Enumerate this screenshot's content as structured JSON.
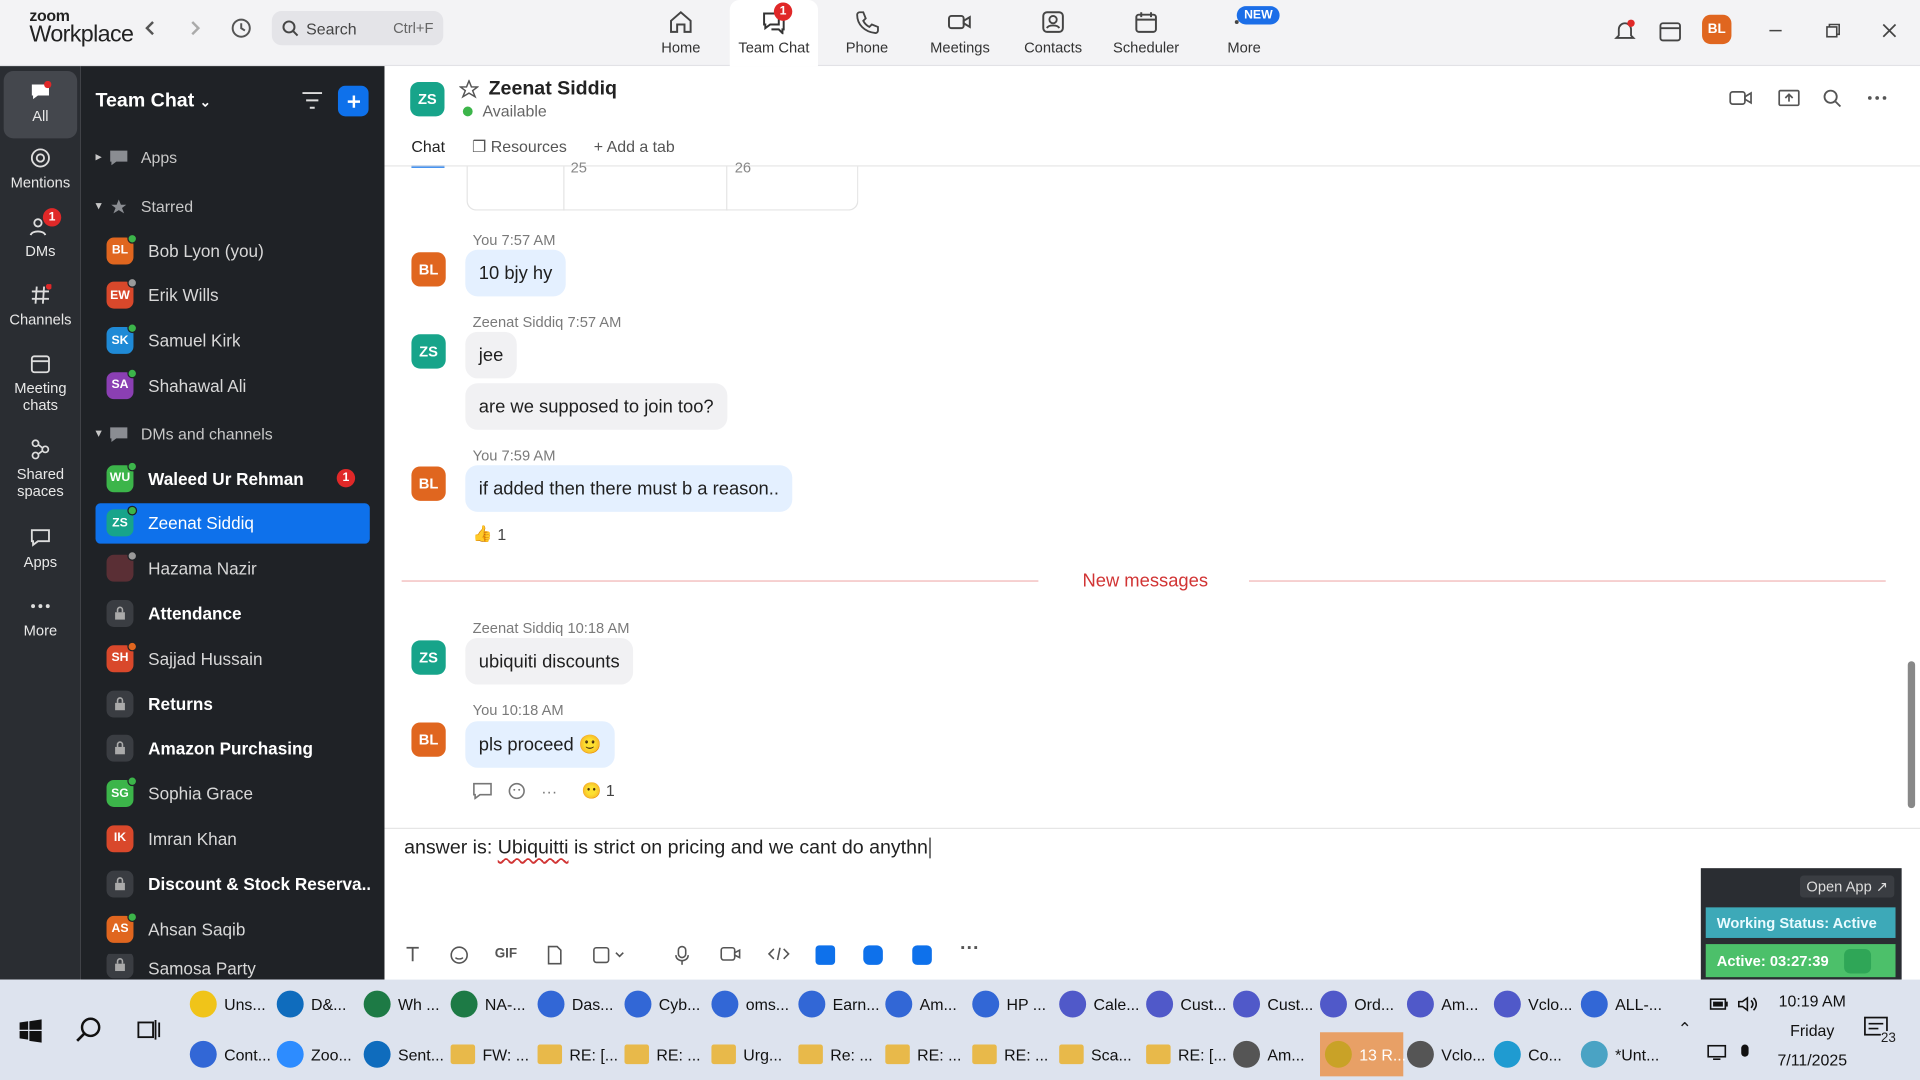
{
  "app": {
    "logo_line1": "zoom",
    "logo_line2": "Workplace"
  },
  "search": {
    "placeholder": "Search",
    "shortcut": "Ctrl+F"
  },
  "topnav": [
    {
      "label": "Home",
      "icon": "home-icon"
    },
    {
      "label": "Team Chat",
      "icon": "chat-icon",
      "badge": "1",
      "active": true
    },
    {
      "label": "Phone",
      "icon": "phone-icon"
    },
    {
      "label": "Meetings",
      "icon": "video-icon"
    },
    {
      "label": "Contacts",
      "icon": "contacts-icon"
    },
    {
      "label": "Scheduler",
      "icon": "calendar-icon"
    },
    {
      "label": "More",
      "icon": "more-icon",
      "badge": "NEW"
    }
  ],
  "user": {
    "initials": "BL",
    "color": "#e0661f"
  },
  "rail": [
    {
      "label": "All",
      "active": true
    },
    {
      "label": "Mentions"
    },
    {
      "label": "DMs",
      "badge": "1"
    },
    {
      "label": "Channels"
    },
    {
      "label": "Meeting chats"
    },
    {
      "label": "Shared spaces"
    },
    {
      "label": "Apps"
    },
    {
      "label": "More"
    }
  ],
  "sidebar": {
    "title": "Team Chat",
    "apps": "Apps",
    "starred": "Starred",
    "dms": "DMs and channels",
    "starred_items": [
      {
        "initials": "BL",
        "name": "Bob Lyon (you)",
        "color": "#e0661f",
        "status": "#3cb54a"
      },
      {
        "initials": "EW",
        "name": "Erik Wills",
        "color": "#d9482b",
        "status": "#9a9a9a"
      },
      {
        "initials": "SK",
        "name": "Samuel Kirk",
        "color": "#1f8ad6",
        "status": "#3cb54a"
      },
      {
        "initials": "SA",
        "name": "Shahawal Ali",
        "color": "#8b3fb3",
        "status": "#3cb54a"
      }
    ],
    "channels": [
      {
        "initials": "WU",
        "name": "Waleed Ur Rehman",
        "color": "#3cb54a",
        "status": "#3cb54a",
        "bold": true,
        "badge": "1"
      },
      {
        "initials": "ZS",
        "name": "Zeenat Siddiq",
        "color": "#17a48a",
        "status": "#3cb54a",
        "selected": true
      },
      {
        "initials": "",
        "name": "Hazama Nazir",
        "color": "#5a2f35",
        "status": "#9a9a9a"
      },
      {
        "initials": "lock",
        "name": "Attendance",
        "bold": true
      },
      {
        "initials": "SH",
        "name": "Sajjad Hussain",
        "color": "#d9482b",
        "status": "#e0661f"
      },
      {
        "initials": "lock",
        "name": "Returns",
        "bold": true
      },
      {
        "initials": "lock",
        "name": "Amazon Purchasing",
        "bold": true
      },
      {
        "initials": "SG",
        "name": "Sophia Grace",
        "color": "#3cb54a",
        "status": "#3cb54a"
      },
      {
        "initials": "IK",
        "name": "Imran Khan",
        "color": "#d9482b"
      },
      {
        "initials": "lock",
        "name": "Discount & Stock Reserva...",
        "bold": true
      },
      {
        "initials": "AS",
        "name": "Ahsan Saqib",
        "color": "#e0661f",
        "status": "#3cb54a"
      },
      {
        "initials": "lock",
        "name": "Samosa Party"
      }
    ]
  },
  "chat_header": {
    "initials": "ZS",
    "name": "Zeenat Siddiq",
    "status": "Available",
    "tabs": [
      "Chat",
      "Resources",
      "Add a tab"
    ]
  },
  "calendar_fragment": {
    "left": "25",
    "right": "26"
  },
  "messages": [
    {
      "sender": "You",
      "time": "7:57 AM",
      "initials": "BL",
      "text": "10 bjy hy",
      "me": true
    },
    {
      "sender": "Zeenat Siddiq",
      "time": "7:57 AM",
      "initials": "ZS",
      "text": "jee",
      "me": false
    },
    {
      "text": "are we supposed to join too?",
      "me": false
    },
    {
      "sender": "You",
      "time": "7:59 AM",
      "initials": "BL",
      "text": "if added then there must b a reason..",
      "me": true,
      "reaction": "1"
    },
    {
      "sender": "Zeenat Siddiq",
      "time": "10:18 AM",
      "initials": "ZS",
      "text": "ubiquiti discounts",
      "me": false
    },
    {
      "sender": "You",
      "time": "10:18 AM",
      "initials": "BL",
      "text": "pls proceed",
      "emoji": "🙂",
      "me": true,
      "reaction": "1"
    }
  ],
  "new_messages_label": "New messages",
  "compose": {
    "prefix": "answer is: ",
    "misspelled": "Ubiquitti",
    "rest": " is strict on pricing and we cant do anythn"
  },
  "widget": {
    "open_app": "Open App ↗",
    "working_status": "Working Status: Active",
    "active": "Active: 03:27:39"
  },
  "taskbar": {
    "row1": [
      "Uns...",
      "D&...",
      "Wh ...",
      "NA-...",
      "Das...",
      "Cyb...",
      "oms...",
      "Earn...",
      "Am...",
      "HP ...",
      "Cale...",
      "Cust...",
      "Cust...",
      "Ord...",
      "Am...",
      "Vclo...",
      "ALL-..."
    ],
    "row2": [
      "Cont...",
      "Zoo...",
      "Sent...",
      "FW: ...",
      "RE: [...",
      "RE: ...",
      "Urg...",
      "Re: ...",
      "RE: ...",
      "RE: ...",
      "Sca...",
      "RE: [...",
      "Am...",
      "13 R...",
      "Vclo...",
      "Co...",
      "*Unt..."
    ],
    "time": "10:19 AM",
    "day": "Friday",
    "date": "7/11/2025",
    "notif": "23"
  }
}
